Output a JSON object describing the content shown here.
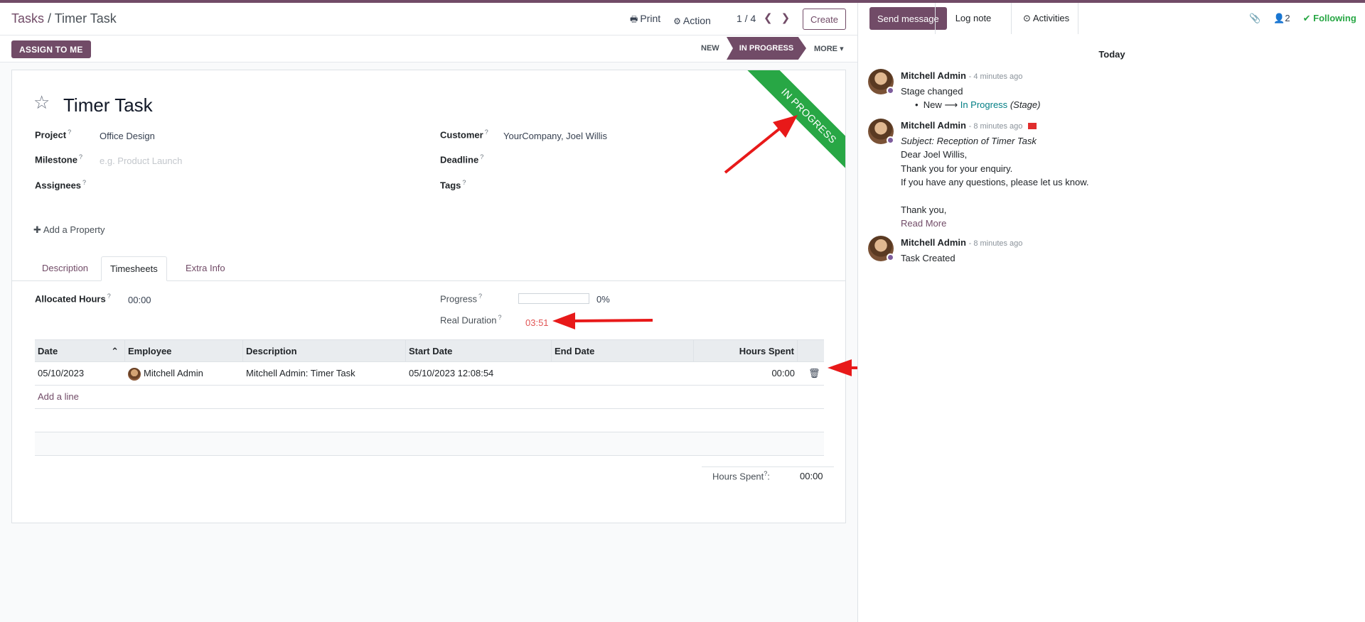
{
  "breadcrumb": {
    "parent": "Tasks",
    "separator": "/",
    "current": "Timer Task"
  },
  "toolbar": {
    "print": "Print",
    "action": "Action",
    "pager": "1 / 4",
    "create": "Create"
  },
  "statusbar": {
    "assign": "ASSIGN TO ME",
    "stages": [
      "NEW",
      "IN PROGRESS"
    ],
    "more": "MORE"
  },
  "ribbon": "IN PROGRESS",
  "task": {
    "title": "Timer Task",
    "project_label": "Project",
    "project": "Office Design",
    "milestone_label": "Milestone",
    "milestone_placeholder": "e.g. Product Launch",
    "assignees_label": "Assignees",
    "customer_label": "Customer",
    "customer": "YourCompany, Joel Willis",
    "deadline_label": "Deadline",
    "tags_label": "Tags",
    "add_property": "Add a Property",
    "help_mark": "?"
  },
  "tabs": [
    "Description",
    "Timesheets",
    "Extra Info"
  ],
  "timesheet": {
    "allocated_label": "Allocated Hours",
    "allocated": "00:00",
    "progress_label": "Progress",
    "progress": "0%",
    "progress_value": 0,
    "real_duration_label": "Real Duration",
    "real_duration": "03:51",
    "columns": [
      "Date",
      "Employee",
      "Description",
      "Start Date",
      "End Date",
      "Hours Spent"
    ],
    "rows": [
      {
        "date": "05/10/2023",
        "employee": "Mitchell Admin",
        "description": "Mitchell Admin: Timer Task",
        "start": "05/10/2023 12:08:54",
        "end": "",
        "hours": "00:00"
      }
    ],
    "add_line": "Add a line",
    "total_label": "Hours Spent",
    "total_colon": ":",
    "total": "00:00"
  },
  "chatter": {
    "send": "Send message",
    "log": "Log note",
    "activities": "Activities",
    "followers_count": "2",
    "following": "Following",
    "today": "Today",
    "messages": [
      {
        "author": "Mitchell Admin",
        "time": "- 4 minutes ago",
        "line1": "Stage changed",
        "from": "New",
        "to": "In Progress",
        "field": "(Stage)"
      },
      {
        "author": "Mitchell Admin",
        "time": "- 8 minutes ago",
        "subject": "Subject: Reception of Timer Task",
        "greeting": "Dear Joel Willis,",
        "l1": "Thank you for your enquiry.",
        "l2": "If you have any questions, please let us know.",
        "l3": "Thank you,",
        "read_more": "Read More"
      },
      {
        "author": "Mitchell Admin",
        "time": "- 8 minutes ago",
        "line1": "Task Created"
      }
    ]
  },
  "colors": {
    "brand": "#714b67",
    "ribbon": "#28a745",
    "arrow": "#e81919",
    "following": "#28a745",
    "stage_link": "#017e84"
  }
}
